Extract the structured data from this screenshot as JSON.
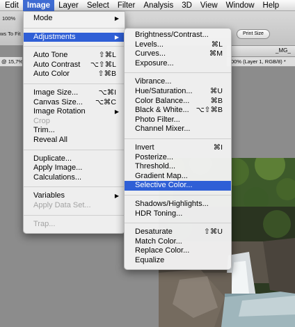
{
  "menubar": {
    "items": [
      {
        "label": "Edit",
        "active": false
      },
      {
        "label": "Image",
        "active": true
      },
      {
        "label": "Layer",
        "active": false
      },
      {
        "label": "Select",
        "active": false
      },
      {
        "label": "Filter",
        "active": false
      },
      {
        "label": "Analysis",
        "active": false
      },
      {
        "label": "3D",
        "active": false
      },
      {
        "label": "View",
        "active": false
      },
      {
        "label": "Window",
        "active": false
      },
      {
        "label": "Help",
        "active": false
      }
    ]
  },
  "options_bar": {
    "zoom_value": "100%",
    "fit_label": "ws To Fit",
    "print_size_button": "Print Size"
  },
  "document": {
    "title": "_MG_",
    "tab_left": "@ 15,7%",
    "tab_right": "00% (Layer 1, RGB/8) *"
  },
  "image_menu": {
    "groups": [
      [
        {
          "label": "Mode",
          "shortcut": "",
          "submenu": true,
          "disabled": false
        }
      ],
      [
        {
          "label": "Adjustments",
          "shortcut": "",
          "submenu": true,
          "disabled": false,
          "highlighted": true
        }
      ],
      [
        {
          "label": "Auto Tone",
          "shortcut": "⇧⌘L",
          "disabled": false
        },
        {
          "label": "Auto Contrast",
          "shortcut": "⌥⇧⌘L",
          "disabled": false
        },
        {
          "label": "Auto Color",
          "shortcut": "⇧⌘B",
          "disabled": false
        }
      ],
      [
        {
          "label": "Image Size...",
          "shortcut": "⌥⌘I",
          "disabled": false
        },
        {
          "label": "Canvas Size...",
          "shortcut": "⌥⌘C",
          "disabled": false
        },
        {
          "label": "Image Rotation",
          "shortcut": "",
          "submenu": true,
          "disabled": false
        },
        {
          "label": "Crop",
          "shortcut": "",
          "disabled": true
        },
        {
          "label": "Trim...",
          "shortcut": "",
          "disabled": false
        },
        {
          "label": "Reveal All",
          "shortcut": "",
          "disabled": false
        }
      ],
      [
        {
          "label": "Duplicate...",
          "shortcut": "",
          "disabled": false
        },
        {
          "label": "Apply Image...",
          "shortcut": "",
          "disabled": false
        },
        {
          "label": "Calculations...",
          "shortcut": "",
          "disabled": false
        }
      ],
      [
        {
          "label": "Variables",
          "shortcut": "",
          "submenu": true,
          "disabled": false
        },
        {
          "label": "Apply Data Set...",
          "shortcut": "",
          "disabled": true
        }
      ],
      [
        {
          "label": "Trap...",
          "shortcut": "",
          "disabled": true
        }
      ]
    ]
  },
  "adjustments_menu": {
    "groups": [
      [
        {
          "label": "Brightness/Contrast...",
          "shortcut": ""
        },
        {
          "label": "Levels...",
          "shortcut": "⌘L"
        },
        {
          "label": "Curves...",
          "shortcut": "⌘M"
        },
        {
          "label": "Exposure...",
          "shortcut": ""
        }
      ],
      [
        {
          "label": "Vibrance...",
          "shortcut": ""
        },
        {
          "label": "Hue/Saturation...",
          "shortcut": "⌘U"
        },
        {
          "label": "Color Balance...",
          "shortcut": "⌘B"
        },
        {
          "label": "Black & White...",
          "shortcut": "⌥⇧⌘B"
        },
        {
          "label": "Photo Filter...",
          "shortcut": ""
        },
        {
          "label": "Channel Mixer...",
          "shortcut": ""
        }
      ],
      [
        {
          "label": "Invert",
          "shortcut": "⌘I"
        },
        {
          "label": "Posterize...",
          "shortcut": ""
        },
        {
          "label": "Threshold...",
          "shortcut": ""
        },
        {
          "label": "Gradient Map...",
          "shortcut": ""
        },
        {
          "label": "Selective Color...",
          "shortcut": "",
          "highlighted": true
        }
      ],
      [
        {
          "label": "Shadows/Highlights...",
          "shortcut": ""
        },
        {
          "label": "HDR Toning...",
          "shortcut": ""
        }
      ],
      [
        {
          "label": "Desaturate",
          "shortcut": "⇧⌘U"
        },
        {
          "label": "Match Color...",
          "shortcut": ""
        },
        {
          "label": "Replace Color...",
          "shortcut": ""
        },
        {
          "label": "Equalize",
          "shortcut": ""
        }
      ]
    ]
  },
  "icons": {
    "submenu_arrow": "submenu-arrow-icon",
    "dropdown": "chevron-down-icon"
  }
}
